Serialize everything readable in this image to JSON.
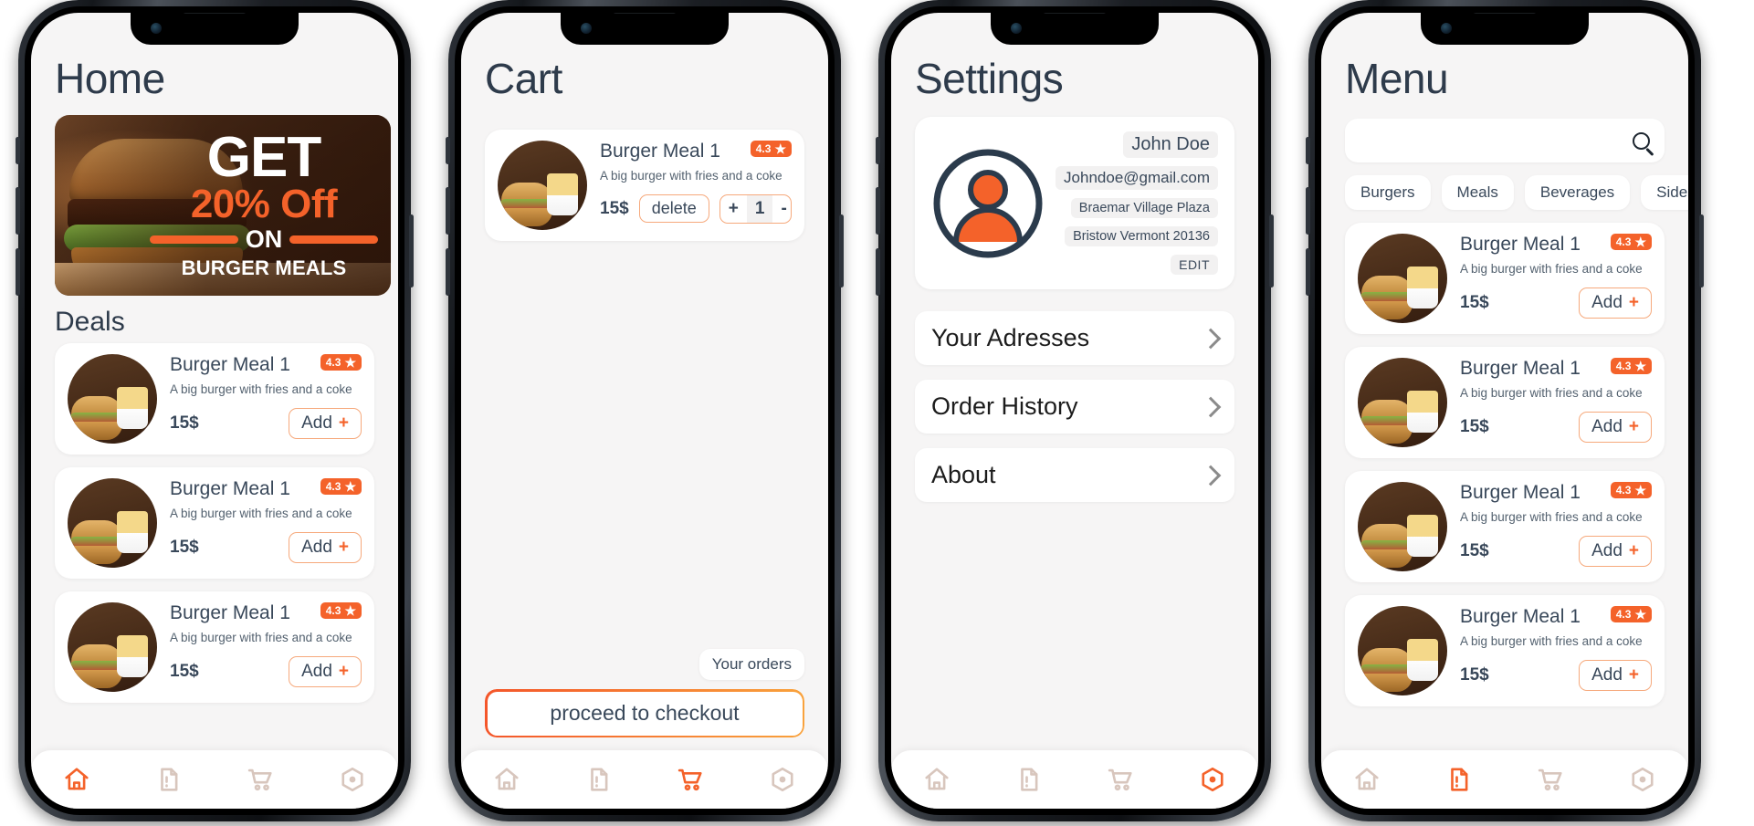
{
  "brand": {
    "accent": "#f4622a",
    "accent_soft": "#f6a97c",
    "text_dark": "#39485a",
    "screen_bg": "#f6f5f5"
  },
  "item": {
    "name": "Burger Meal 1",
    "description": "A big burger with fries and a coke",
    "price": "15$",
    "rating": "4.3",
    "star": "★",
    "add_label": "Add",
    "add_plus": "+"
  },
  "nav": {
    "items": [
      {
        "label": "Home",
        "icon": "home-icon"
      },
      {
        "label": "Menu",
        "icon": "document-icon"
      },
      {
        "label": "Cart",
        "icon": "cart-icon"
      },
      {
        "label": "Settings",
        "icon": "hexagon-settings-icon"
      }
    ]
  },
  "home": {
    "title": "Home",
    "promo": {
      "get": "GET",
      "discount": "20% Off",
      "on": "ON",
      "target": "BURGER MEALS"
    },
    "section_title": "Deals",
    "deals": [
      {
        "name": "Burger Meal 1",
        "description": "A big burger with fries and a coke",
        "price": "15$",
        "rating": "4.3",
        "add_label": "Add"
      },
      {
        "name": "Burger Meal 1",
        "description": "A big burger with fries and a coke",
        "price": "15$",
        "rating": "4.3",
        "add_label": "Add"
      },
      {
        "name": "Burger Meal 1",
        "description": "A big burger with fries and a coke",
        "price": "15$",
        "rating": "4.3",
        "add_label": "Add"
      }
    ],
    "active_nav": "Home"
  },
  "cart": {
    "title": "Cart",
    "line_items": [
      {
        "name": "Burger Meal 1",
        "description": "A big burger with fries and a coke",
        "price": "15$",
        "rating": "4.3",
        "delete_label": "delete",
        "increment": "+",
        "quantity": "1",
        "decrement": "-"
      }
    ],
    "your_orders_label": "Your orders",
    "checkout_label": "proceed to checkout",
    "active_nav": "Cart"
  },
  "settings": {
    "title": "Settings",
    "profile": {
      "name": "John Doe",
      "email": "Johndoe@gmail.com",
      "address_line1": "Braemar Village Plaza",
      "address_line2": "Bristow Vermont 20136",
      "edit_label": "EDIT"
    },
    "rows": [
      {
        "label": "Your Adresses"
      },
      {
        "label": "Order History"
      },
      {
        "label": "About"
      }
    ],
    "active_nav": "Settings"
  },
  "menu": {
    "title": "Menu",
    "search_placeholder": "",
    "search_value": "",
    "categories": [
      {
        "label": "Burgers"
      },
      {
        "label": "Meals"
      },
      {
        "label": "Beverages"
      },
      {
        "label": "Sides"
      }
    ],
    "items": [
      {
        "name": "Burger Meal 1",
        "description": "A big burger with fries and a coke",
        "price": "15$",
        "rating": "4.3",
        "add_label": "Add"
      },
      {
        "name": "Burger Meal 1",
        "description": "A big burger with fries and a coke",
        "price": "15$",
        "rating": "4.3",
        "add_label": "Add"
      },
      {
        "name": "Burger Meal 1",
        "description": "A big burger with fries and a coke",
        "price": "15$",
        "rating": "4.3",
        "add_label": "Add"
      },
      {
        "name": "Burger Meal 1",
        "description": "A big burger with fries and a coke",
        "price": "15$",
        "rating": "4.3",
        "add_label": "Add"
      }
    ],
    "active_nav": "Menu"
  }
}
